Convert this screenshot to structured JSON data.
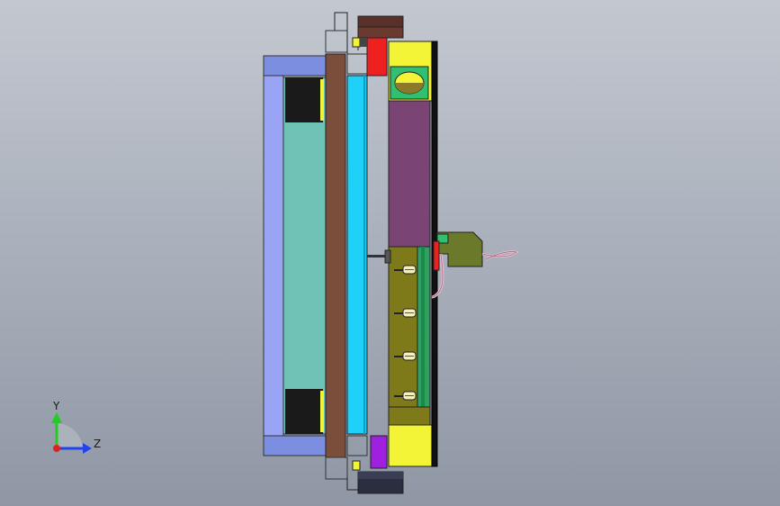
{
  "viewport": {
    "background_top": "#c3c8d0",
    "background_bottom": "#8f97a5"
  },
  "triad": {
    "y_label": "Y",
    "z_label": "Z",
    "y_color": "#22cc22",
    "z_color": "#2244ee",
    "x_color": "#dd2222"
  },
  "colors": {
    "frame_blue": "#8c9cf0",
    "frame_blue_dark": "#6f86d8",
    "teal_panel": "#6ec2b6",
    "black_block": "#1a1a1a",
    "brown_plate": "#7b4e3c",
    "cyan_plate": "#1fd0f8",
    "yellow": "#f4f436",
    "purple": "#7a4474",
    "olive": "#7e7a1a",
    "green": "#30a060",
    "red": "#ee2020",
    "violet": "#a020e0",
    "maroon": "#5a3028",
    "navy": "#2a2e40",
    "valve": "#6a7a2a"
  }
}
